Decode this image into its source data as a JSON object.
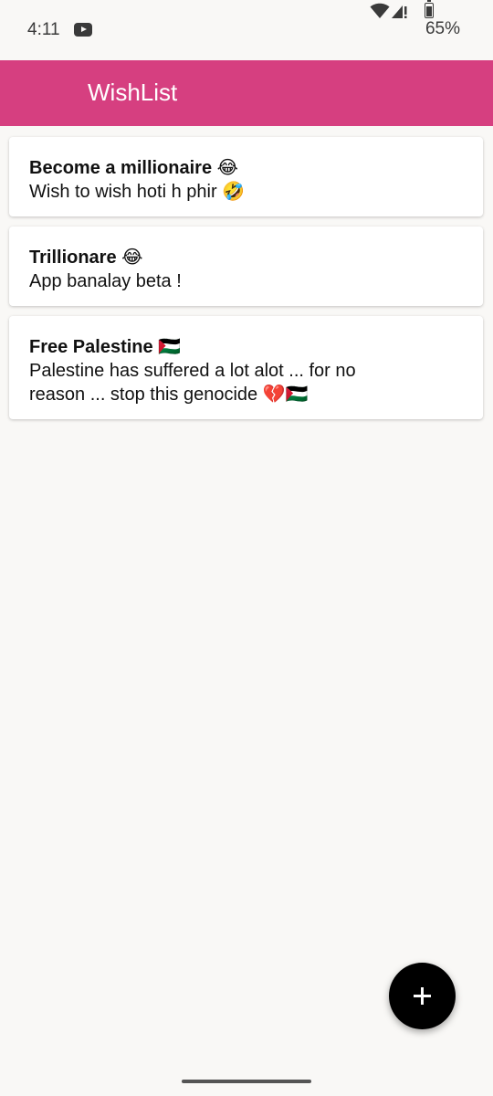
{
  "status_bar": {
    "time": "4:11",
    "battery": "65%",
    "battery_level": 0.65,
    "icons": [
      "youtube-icon",
      "wifi-icon",
      "signal-icon",
      "battery-icon"
    ]
  },
  "app_bar": {
    "title": "WishList",
    "color": "#d63f80"
  },
  "wishes": [
    {
      "title": "Become a millionaire 😂",
      "description": "Wish to wish hoti h phir 🤣"
    },
    {
      "title": "Trillionare 😂",
      "description": "App banalay beta !"
    },
    {
      "title": "Free Palestine 🇵🇸",
      "description": "Palestine has suffered a lot alot ... for no reason ... stop this genocide 💔🇵🇸"
    }
  ],
  "fab": {
    "icon": "plus-icon",
    "color": "#000000"
  }
}
